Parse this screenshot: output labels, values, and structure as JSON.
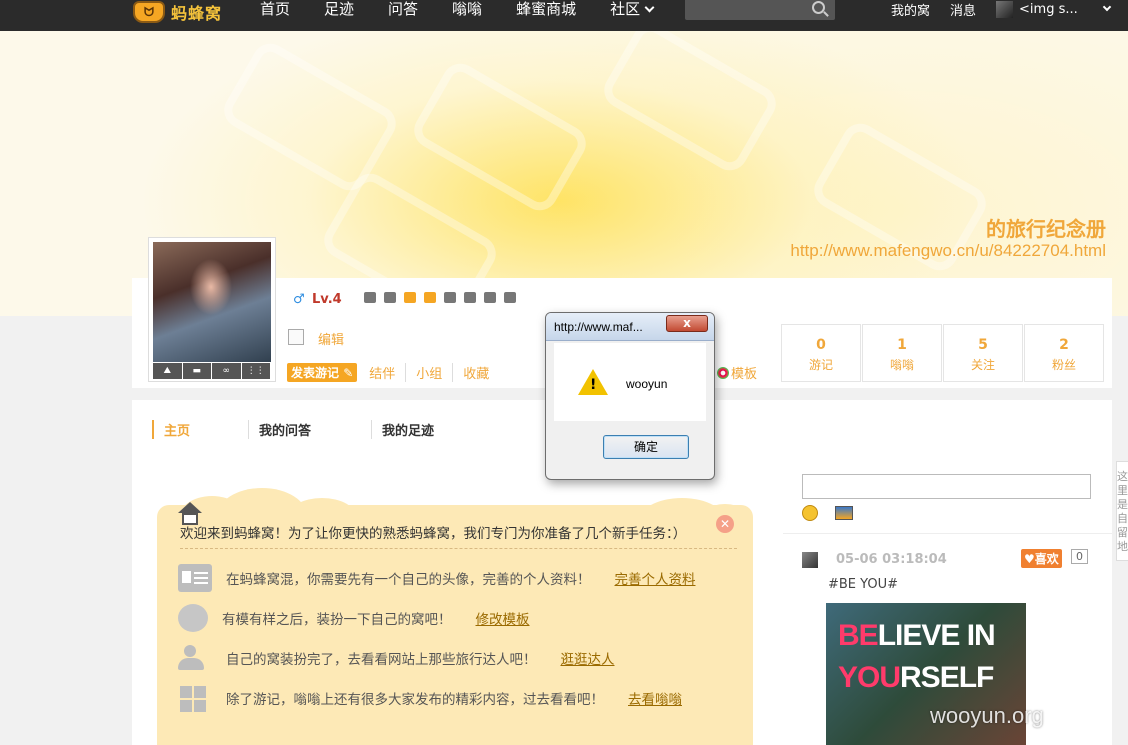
{
  "nav": {
    "logo_text": "蚂蜂窝",
    "items": [
      "首页",
      "足迹",
      "问答",
      "嗡嗡",
      "蜂蜜商城",
      "社区"
    ],
    "right": {
      "my_nest": "我的窝",
      "messages": "消息",
      "user": "<img s..."
    }
  },
  "banner": {
    "title": "的旅行纪念册",
    "url": "http://www.mafengwo.cn/u/84222704.html"
  },
  "profile": {
    "gender_symbol": "♂",
    "level": "Lv.4",
    "edit": "编辑",
    "post_button": "发表游记",
    "links": [
      "结伴",
      "小组",
      "收藏"
    ],
    "template": "模板",
    "stats": [
      {
        "value": "0",
        "label": "游记"
      },
      {
        "value": "1",
        "label": "嗡嗡"
      },
      {
        "value": "5",
        "label": "关注"
      },
      {
        "value": "2",
        "label": "粉丝"
      }
    ]
  },
  "tabs": [
    "主页",
    "我的问答",
    "我的足迹"
  ],
  "welcome": {
    "text": "欢迎来到蚂蜂窝！为了让你更快的熟悉蚂蜂窝，我们专门为你准备了几个新手任务：）",
    "close": "✕",
    "tasks": [
      {
        "text": "在蚂蜂窝混，你需要先有一个自己的头像，完善的个人资料！",
        "link": "完善个人资料",
        "icon": "profile-card-icon"
      },
      {
        "text": "有模有样之后，装扮一下自己的窝吧！",
        "link": "修改模板",
        "icon": "palette-icon"
      },
      {
        "text": "自己的窝装扮完了，去看看网站上那些旅行达人吧！",
        "link": "逛逛达人",
        "icon": "people-icon"
      },
      {
        "text": "除了游记，嗡嗡上还有很多大家发布的精彩内容，过去看看吧！",
        "link": "去看嗡嗡",
        "icon": "grid-icon"
      }
    ]
  },
  "feed": {
    "time": "05-06 03:18:04",
    "like": "♥喜欢",
    "like_count": "0",
    "tag": "#BE YOU#",
    "image_line1_pink": "BE",
    "image_line1_rest": "LIEVE IN",
    "image_line2_pink": "YOU",
    "image_line2_rest": "RSELF"
  },
  "side_tab": "这里是自留地",
  "watermark": "wooyun.org",
  "dialog": {
    "title": "http://www.maf...",
    "close": "x",
    "message": "wooyun",
    "ok": "确定"
  },
  "colors": {
    "accent": "#f0a73a",
    "topbar": "#2b2b2b",
    "cloud": "#fde9b6"
  }
}
